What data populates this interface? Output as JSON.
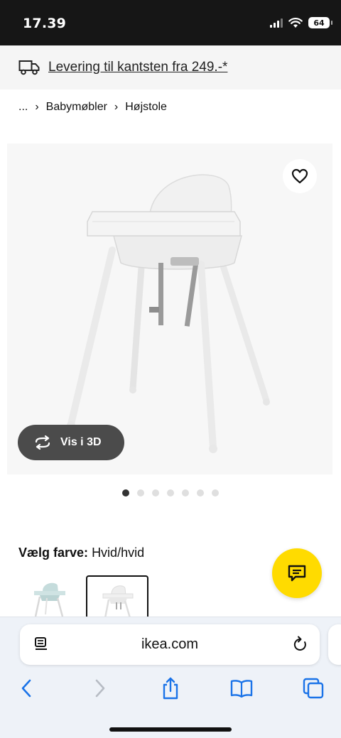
{
  "status_bar": {
    "time": "17.39",
    "battery": "64"
  },
  "delivery_banner": {
    "text": "Levering til kantsten fra 249.-*"
  },
  "breadcrumb": {
    "ellipsis": "...",
    "items": [
      "Babymøbler",
      "Højstole"
    ]
  },
  "product": {
    "view_3d_label": "Vis i 3D",
    "image_count": 7,
    "active_image": 1
  },
  "color_selector": {
    "label": "Vælg farve:",
    "value": "Hvid/hvid"
  },
  "browser": {
    "url": "ikea.com"
  },
  "colors": {
    "accent": "#ffdb00",
    "pill": "#4b4b4b",
    "link_blue": "#1a73e8"
  },
  "icons": [
    "truck-icon",
    "heart-icon",
    "rotate-3d-icon",
    "chat-icon",
    "reader-icon",
    "reload-icon",
    "back-icon",
    "forward-icon",
    "share-icon",
    "bookmarks-icon",
    "tabs-icon"
  ]
}
